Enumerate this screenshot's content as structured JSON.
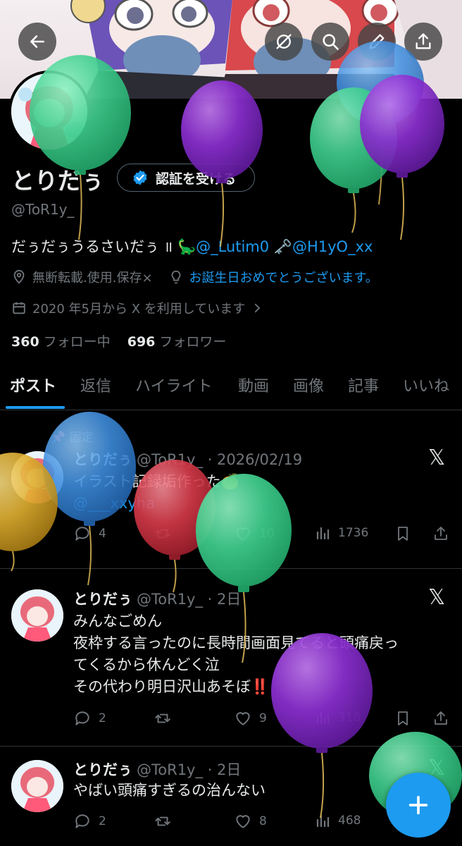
{
  "profile": {
    "display_name": "とりだぅ",
    "handle": "@ToR1y_",
    "verify_label": "認証を受ける",
    "bio_text": "だぅだぅうるさいだぅ ॥ ",
    "bio_dino": "🦕",
    "bio_link1": "@_Lutim0",
    "bio_key": "🗝️",
    "bio_link2": "@H1yO_xx",
    "location": "無断転載.使用.保存×",
    "bulb_link": "お誕生日おめでとうございます。",
    "joined": "2020 年5月から X を利用しています",
    "following_count": "360",
    "following_label": "フォロー中",
    "followers_count": "696",
    "followers_label": "フォロワー"
  },
  "tabs": [
    "ポスト",
    "返信",
    "ハイライト",
    "動画",
    "画像",
    "記事",
    "いいね"
  ],
  "posts": [
    {
      "pinned_label": "固定",
      "name": "とりだぅ",
      "handle_time": "@ToR1y_ · 2026/02/19",
      "lines": [
        "イラスト記録垢作った🍊"
      ],
      "link": "@___xxyha",
      "replies": "4",
      "retweets": "",
      "likes": "10",
      "views": "1736"
    },
    {
      "name": "とりだぅ",
      "handle_time": "@ToR1y_ · 2日",
      "lines": [
        "みんなごめん",
        "夜枠する言ったのに長時間画面見てると頭痛戻っ",
        "てくるから休んどく泣",
        "その代わり明日沢山あそぼ‼️"
      ],
      "replies": "2",
      "retweets": "",
      "likes": "9",
      "views": "318"
    },
    {
      "name": "とりだぅ",
      "handle_time": "@ToR1y_ · 2日",
      "lines": [
        "やばい頭痛すぎるの治んない"
      ],
      "replies": "2",
      "retweets": "",
      "likes": "8",
      "views": "468"
    }
  ],
  "icons": {
    "header": [
      "back-arrow-icon",
      "no-edit-icon",
      "search-icon",
      "pencil-icon",
      "share-icon"
    ],
    "post_actions": [
      "reply-icon",
      "retweet-icon",
      "like-icon",
      "views-icon",
      "bookmark-icon",
      "share-icon"
    ]
  },
  "colors": {
    "accent": "#1d9bf0",
    "background": "#000000",
    "muted_text": "#71767b",
    "balloon_green": "#3fcf8e",
    "balloon_purple": "#8b2fd0",
    "balloon_blue": "#3f8fe0",
    "balloon_red": "#d83a4a",
    "balloon_yellow": "#e0b030"
  }
}
